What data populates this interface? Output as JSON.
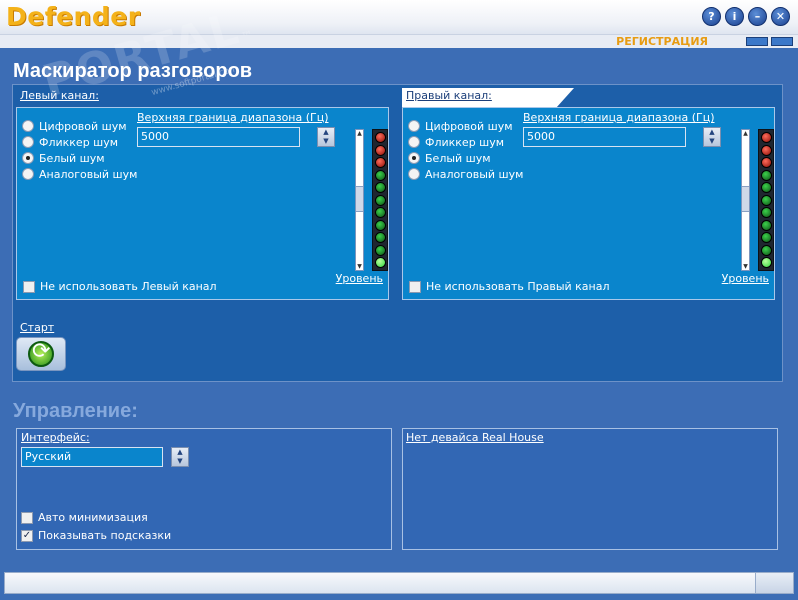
{
  "window": {
    "title": "Defender"
  },
  "titlebar_buttons": {
    "help": "?",
    "info": "i",
    "minimize": "–",
    "close": "✕"
  },
  "header": {
    "register_link": "РЕГИСТРАЦИЯ"
  },
  "masker": {
    "title": "Маскиратор разговоров",
    "left": {
      "tab_label": "Левый канал:",
      "noise_options": [
        "Цифровой шум",
        "Фликкер шум",
        "Белый шум",
        "Аналоговый шум"
      ],
      "selected_index": 2,
      "freq_label": "Верхняя граница диапазона (Гц)",
      "freq_value": "5000",
      "level_link": "Уровень",
      "disable_label": "Не использовать Левый канал",
      "disable_checked": false
    },
    "right": {
      "tab_label": "Правый канал:",
      "noise_options": [
        "Цифровой шум",
        "Фликкер шум",
        "Белый шум",
        "Аналоговый шум"
      ],
      "selected_index": 2,
      "freq_label": "Верхняя граница диапазона (Гц)",
      "freq_value": "5000",
      "level_link": "Уровень",
      "disable_label": "Не использовать Правый канал",
      "disable_checked": false
    },
    "led_states": [
      "red",
      "red",
      "red",
      "green",
      "green",
      "green",
      "green",
      "green",
      "green",
      "green",
      "lit"
    ],
    "start_label": "Старт"
  },
  "control": {
    "title": "Управление:",
    "interface_label": "Интерфейс:",
    "interface_value": "Русский",
    "auto_minimize_label": "Авто минимизация",
    "auto_minimize_checked": false,
    "show_hints_label": "Показывать подсказки",
    "show_hints_checked": true,
    "device_status": "Нет девайса Real House"
  },
  "watermark": {
    "text": "PORTAL",
    "tm": "™",
    "small": "www.softportal.com"
  },
  "colors": {
    "accent": "#f4b21a",
    "panel": "#0a85cc",
    "background": "#3c6db5"
  }
}
